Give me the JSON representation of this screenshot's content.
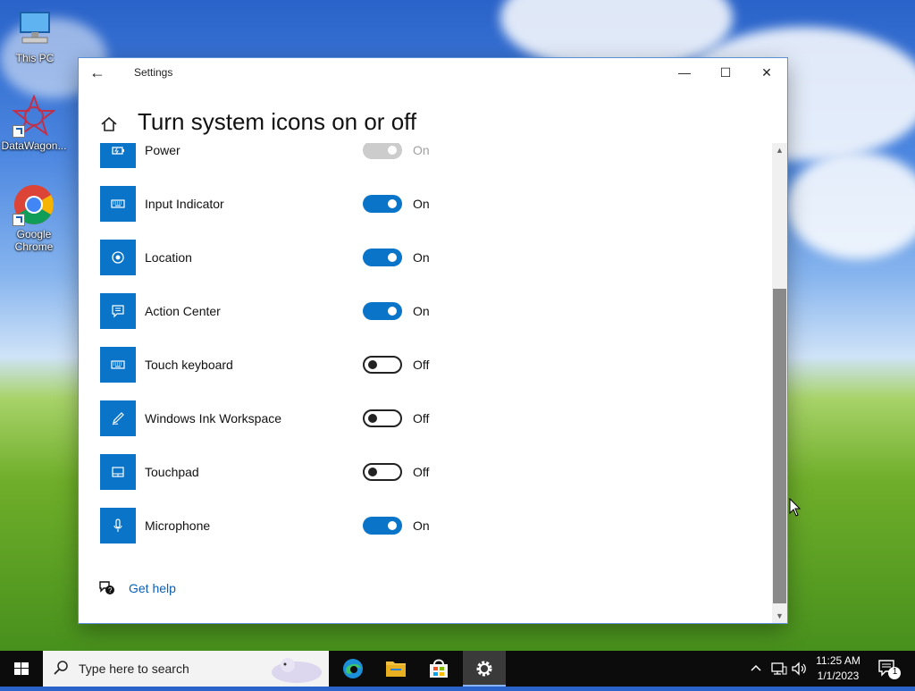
{
  "desktop": {
    "icons": [
      {
        "label": "This PC"
      },
      {
        "label": "DataWagon..."
      },
      {
        "label": "Google Chrome"
      }
    ]
  },
  "window": {
    "title": "Settings",
    "minimize": "—",
    "maximize": "☐",
    "close": "✕",
    "back": "←",
    "page_title": "Turn system icons on or off"
  },
  "items": [
    {
      "label": "Power",
      "state": "On",
      "on": true,
      "disabled": true
    },
    {
      "label": "Input Indicator",
      "state": "On",
      "on": true
    },
    {
      "label": "Location",
      "state": "On",
      "on": true
    },
    {
      "label": "Action Center",
      "state": "On",
      "on": true
    },
    {
      "label": "Touch keyboard",
      "state": "Off",
      "on": false
    },
    {
      "label": "Windows Ink Workspace",
      "state": "Off",
      "on": false
    },
    {
      "label": "Touchpad",
      "state": "Off",
      "on": false
    },
    {
      "label": "Microphone",
      "state": "On",
      "on": true
    }
  ],
  "help": {
    "label": "Get help"
  },
  "taskbar": {
    "search_placeholder": "Type here to search",
    "time": "11:25 AM",
    "date": "1/1/2023",
    "notification_count": "1"
  },
  "colors": {
    "accent": "#0a74c9",
    "link": "#0a5fb8"
  }
}
